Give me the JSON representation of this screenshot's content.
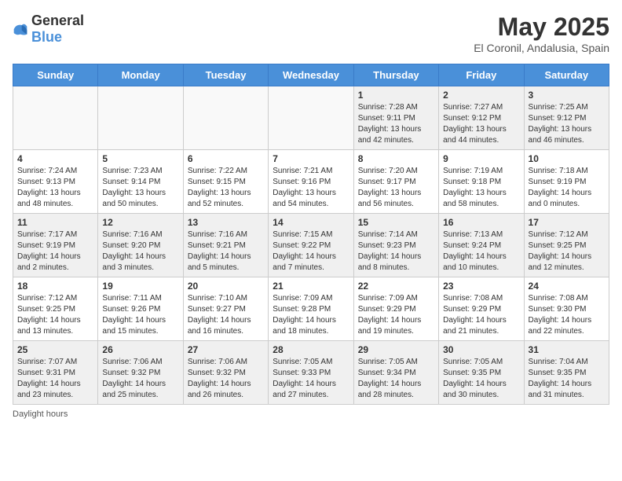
{
  "logo": {
    "text_general": "General",
    "text_blue": "Blue"
  },
  "title": "May 2025",
  "subtitle": "El Coronil, Andalusia, Spain",
  "days_of_week": [
    "Sunday",
    "Monday",
    "Tuesday",
    "Wednesday",
    "Thursday",
    "Friday",
    "Saturday"
  ],
  "weeks": [
    [
      {
        "day": "",
        "info": ""
      },
      {
        "day": "",
        "info": ""
      },
      {
        "day": "",
        "info": ""
      },
      {
        "day": "",
        "info": ""
      },
      {
        "day": "1",
        "info": "Sunrise: 7:28 AM\nSunset: 9:11 PM\nDaylight: 13 hours and 42 minutes."
      },
      {
        "day": "2",
        "info": "Sunrise: 7:27 AM\nSunset: 9:12 PM\nDaylight: 13 hours and 44 minutes."
      },
      {
        "day": "3",
        "info": "Sunrise: 7:25 AM\nSunset: 9:12 PM\nDaylight: 13 hours and 46 minutes."
      }
    ],
    [
      {
        "day": "4",
        "info": "Sunrise: 7:24 AM\nSunset: 9:13 PM\nDaylight: 13 hours and 48 minutes."
      },
      {
        "day": "5",
        "info": "Sunrise: 7:23 AM\nSunset: 9:14 PM\nDaylight: 13 hours and 50 minutes."
      },
      {
        "day": "6",
        "info": "Sunrise: 7:22 AM\nSunset: 9:15 PM\nDaylight: 13 hours and 52 minutes."
      },
      {
        "day": "7",
        "info": "Sunrise: 7:21 AM\nSunset: 9:16 PM\nDaylight: 13 hours and 54 minutes."
      },
      {
        "day": "8",
        "info": "Sunrise: 7:20 AM\nSunset: 9:17 PM\nDaylight: 13 hours and 56 minutes."
      },
      {
        "day": "9",
        "info": "Sunrise: 7:19 AM\nSunset: 9:18 PM\nDaylight: 13 hours and 58 minutes."
      },
      {
        "day": "10",
        "info": "Sunrise: 7:18 AM\nSunset: 9:19 PM\nDaylight: 14 hours and 0 minutes."
      }
    ],
    [
      {
        "day": "11",
        "info": "Sunrise: 7:17 AM\nSunset: 9:19 PM\nDaylight: 14 hours and 2 minutes."
      },
      {
        "day": "12",
        "info": "Sunrise: 7:16 AM\nSunset: 9:20 PM\nDaylight: 14 hours and 3 minutes."
      },
      {
        "day": "13",
        "info": "Sunrise: 7:16 AM\nSunset: 9:21 PM\nDaylight: 14 hours and 5 minutes."
      },
      {
        "day": "14",
        "info": "Sunrise: 7:15 AM\nSunset: 9:22 PM\nDaylight: 14 hours and 7 minutes."
      },
      {
        "day": "15",
        "info": "Sunrise: 7:14 AM\nSunset: 9:23 PM\nDaylight: 14 hours and 8 minutes."
      },
      {
        "day": "16",
        "info": "Sunrise: 7:13 AM\nSunset: 9:24 PM\nDaylight: 14 hours and 10 minutes."
      },
      {
        "day": "17",
        "info": "Sunrise: 7:12 AM\nSunset: 9:25 PM\nDaylight: 14 hours and 12 minutes."
      }
    ],
    [
      {
        "day": "18",
        "info": "Sunrise: 7:12 AM\nSunset: 9:25 PM\nDaylight: 14 hours and 13 minutes."
      },
      {
        "day": "19",
        "info": "Sunrise: 7:11 AM\nSunset: 9:26 PM\nDaylight: 14 hours and 15 minutes."
      },
      {
        "day": "20",
        "info": "Sunrise: 7:10 AM\nSunset: 9:27 PM\nDaylight: 14 hours and 16 minutes."
      },
      {
        "day": "21",
        "info": "Sunrise: 7:09 AM\nSunset: 9:28 PM\nDaylight: 14 hours and 18 minutes."
      },
      {
        "day": "22",
        "info": "Sunrise: 7:09 AM\nSunset: 9:29 PM\nDaylight: 14 hours and 19 minutes."
      },
      {
        "day": "23",
        "info": "Sunrise: 7:08 AM\nSunset: 9:29 PM\nDaylight: 14 hours and 21 minutes."
      },
      {
        "day": "24",
        "info": "Sunrise: 7:08 AM\nSunset: 9:30 PM\nDaylight: 14 hours and 22 minutes."
      }
    ],
    [
      {
        "day": "25",
        "info": "Sunrise: 7:07 AM\nSunset: 9:31 PM\nDaylight: 14 hours and 23 minutes."
      },
      {
        "day": "26",
        "info": "Sunrise: 7:06 AM\nSunset: 9:32 PM\nDaylight: 14 hours and 25 minutes."
      },
      {
        "day": "27",
        "info": "Sunrise: 7:06 AM\nSunset: 9:32 PM\nDaylight: 14 hours and 26 minutes."
      },
      {
        "day": "28",
        "info": "Sunrise: 7:05 AM\nSunset: 9:33 PM\nDaylight: 14 hours and 27 minutes."
      },
      {
        "day": "29",
        "info": "Sunrise: 7:05 AM\nSunset: 9:34 PM\nDaylight: 14 hours and 28 minutes."
      },
      {
        "day": "30",
        "info": "Sunrise: 7:05 AM\nSunset: 9:35 PM\nDaylight: 14 hours and 30 minutes."
      },
      {
        "day": "31",
        "info": "Sunrise: 7:04 AM\nSunset: 9:35 PM\nDaylight: 14 hours and 31 minutes."
      }
    ]
  ],
  "footer": "Daylight hours"
}
